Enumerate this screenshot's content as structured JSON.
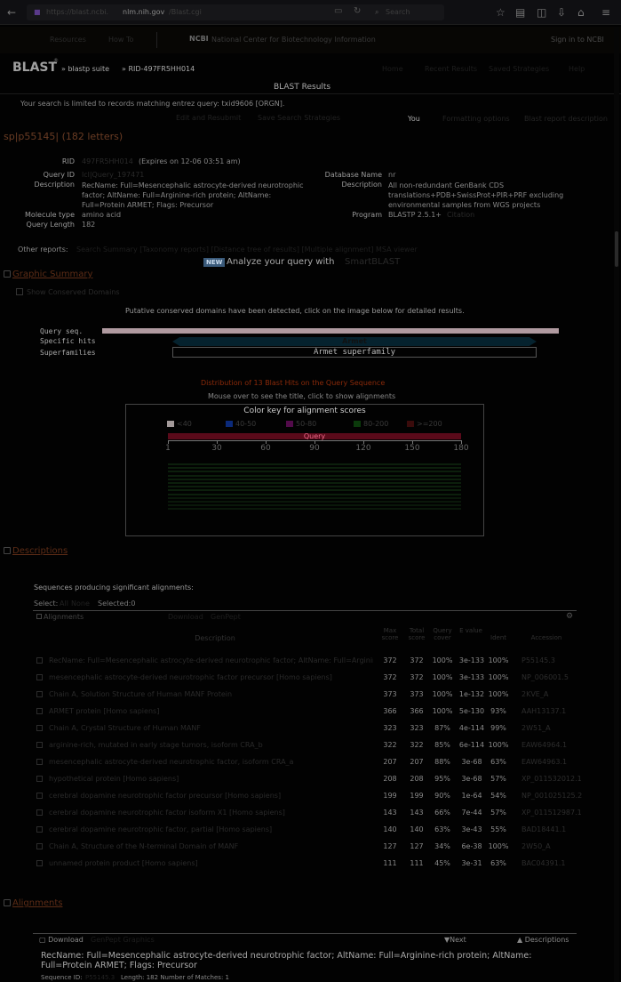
{
  "browser": {
    "url_prefix": "https://blast.ncbi.",
    "url_domain": "nlm.nih.gov",
    "url_suffix": "/Blast.cgi",
    "search_placeholder": "Search"
  },
  "ncbi_bar": {
    "resources": "Resources",
    "howto": "How To",
    "logo": "NCBI",
    "name": "National Center for Biotechnology Information",
    "signin": "Sign in to NCBI"
  },
  "blast_bar": {
    "title": "BLAST",
    "reg": "®",
    "suite": "» blastp suite",
    "rid": "» RID-497FR5HH014",
    "links": [
      "Home",
      "Recent Results",
      "Saved Strategies",
      "Help"
    ]
  },
  "results_title": "BLAST Results",
  "limit_note": "Your search is limited to records matching entrez query: txid9606 [ORGN].",
  "edit_link": "Edit and Resubmit",
  "save_link": "Save Search Strategies",
  "formatting_link": "Formatting options",
  "download_link": "Download",
  "you_may": "You",
  "blast_tutorials": "Blast report description",
  "query_title": "sp|p55145| (182 letters)",
  "summary": {
    "rid_label": "RID",
    "rid_value": "497FR5HH014",
    "expires": "(Expires on 12-06 03:51 am)",
    "qid_label": "Query ID",
    "qid_value": "lcl|Query_197471",
    "desc_label": "Description",
    "desc_value": "RecName: Full=Mesencephalic astrocyte-derived neurotrophic factor; AltName: Full=Arginine-rich protein; AltName: Full=Protein ARMET; Flags: Precursor",
    "moltype_label": "Molecule type",
    "moltype_value": "amino acid",
    "qlen_label": "Query Length",
    "qlen_value": "182",
    "db_label": "Database Name",
    "db_value": "nr",
    "dbdesc_label": "Description",
    "dbdesc_value": "All non-redundant GenBank CDS translations+PDB+SwissProt+PIR+PRF excluding environmental samples from WGS projects",
    "program_label": "Program",
    "program_value": "BLASTP 2.5.1+",
    "citation": "Citation"
  },
  "other_reports": {
    "label": "Other reports:",
    "links": "Search Summary  [Taxonomy reports]  [Distance tree of results]  [Multiple alignment]  MSA viewer"
  },
  "new_badge": "NEW",
  "analyze_text": "Analyze your query with",
  "analyze_link": "SmartBLAST",
  "graphic_summary": {
    "heading": "Graphic Summary",
    "subheading": "Show Conserved Domains",
    "note": "Putative conserved domains have been detected, click on the image below for detailed results.",
    "row_labels": [
      "Query seq.",
      "Specific hits",
      "Superfamilies"
    ],
    "specific_hit": "Armet",
    "superfamily": "Armet superfamily"
  },
  "distribution": {
    "title": "Distribution of 13 Blast Hits on the Query Sequence",
    "subtitle": "Mouse over to see the title, click to show alignments",
    "key_title": "Color key for alignment scores",
    "legend": [
      {
        "label": "<40",
        "color": "#a39a9a"
      },
      {
        "label": "40-50",
        "color": "#0b2a7a"
      },
      {
        "label": "50-80",
        "color": "#520b4a"
      },
      {
        "label": "80-200",
        "color": "#0b3a0b"
      },
      {
        "label": ">=200",
        "color": "#3a0b0b"
      }
    ],
    "query_label": "Query",
    "ticks": [
      "1",
      "30",
      "60",
      "90",
      "120",
      "150",
      "180"
    ],
    "hit_count": 13
  },
  "descriptions": {
    "heading": "Descriptions",
    "producing": "Sequences producing significant alignments:",
    "select_label": "Select:",
    "select_all": "All",
    "select_none": "None",
    "selected": "Selected:0",
    "alignments_label": "Alignments",
    "download": "Download",
    "graphics": "GenPept",
    "columns": [
      "Description",
      "Max score",
      "Total score",
      "Query cover",
      "E value",
      "Ident",
      "Accession"
    ],
    "rows": [
      {
        "desc": "RecName: Full=Mesencephalic astrocyte-derived neurotrophic factor; AltName: Full=Arginine-rich protein",
        "max": "372",
        "total": "372",
        "cover": "100%",
        "e": "3e-133",
        "ident": "100%",
        "acc": "P55145.3"
      },
      {
        "desc": "mesencephalic astrocyte-derived neurotrophic factor precursor [Homo sapiens]",
        "max": "372",
        "total": "372",
        "cover": "100%",
        "e": "3e-133",
        "ident": "100%",
        "acc": "NP_006001.5"
      },
      {
        "desc": "Chain A, Solution Structure of Human MANF Protein",
        "max": "373",
        "total": "373",
        "cover": "100%",
        "e": "1e-132",
        "ident": "100%",
        "acc": "2KVE_A"
      },
      {
        "desc": "ARMET protein [Homo sapiens]",
        "max": "366",
        "total": "366",
        "cover": "100%",
        "e": "5e-130",
        "ident": "93%",
        "acc": "AAH13137.1"
      },
      {
        "desc": "Chain A, Crystal Structure of Human MANF",
        "max": "323",
        "total": "323",
        "cover": "87%",
        "e": "4e-114",
        "ident": "99%",
        "acc": "2W51_A"
      },
      {
        "desc": "arginine-rich, mutated in early stage tumors, isoform CRA_b",
        "max": "322",
        "total": "322",
        "cover": "85%",
        "e": "6e-114",
        "ident": "100%",
        "acc": "EAW64964.1"
      },
      {
        "desc": "mesencephalic astrocyte-derived neurotrophic factor, isoform CRA_a",
        "max": "207",
        "total": "207",
        "cover": "88%",
        "e": "3e-68",
        "ident": "63%",
        "acc": "EAW64963.1"
      },
      {
        "desc": "hypothetical protein [Homo sapiens]",
        "max": "208",
        "total": "208",
        "cover": "95%",
        "e": "3e-68",
        "ident": "57%",
        "acc": "XP_011532012.1"
      },
      {
        "desc": "cerebral dopamine neurotrophic factor precursor [Homo sapiens]",
        "max": "199",
        "total": "199",
        "cover": "90%",
        "e": "1e-64",
        "ident": "54%",
        "acc": "NP_001025125.2"
      },
      {
        "desc": "cerebral dopamine neurotrophic factor isoform X1 [Homo sapiens]",
        "max": "143",
        "total": "143",
        "cover": "66%",
        "e": "7e-44",
        "ident": "57%",
        "acc": "XP_011512987.1"
      },
      {
        "desc": "cerebral dopamine neurotrophic factor, partial [Homo sapiens]",
        "max": "140",
        "total": "140",
        "cover": "63%",
        "e": "3e-43",
        "ident": "55%",
        "acc": "BAD18441.1"
      },
      {
        "desc": "Chain A, Structure of the N-terminal Domain of MANF",
        "max": "127",
        "total": "127",
        "cover": "34%",
        "e": "6e-38",
        "ident": "100%",
        "acc": "2W50_A"
      },
      {
        "desc": "unnamed protein product [Homo sapiens]",
        "max": "111",
        "total": "111",
        "cover": "45%",
        "e": "3e-31",
        "ident": "63%",
        "acc": "BAC04391.1"
      }
    ]
  },
  "alignments": {
    "heading": "Alignments",
    "download": "Download",
    "graphics_link": "GenPept  Graphics",
    "sort_label": "Next",
    "desc_link": "Descriptions",
    "first_title": "RecName: Full=Mesencephalic astrocyte-derived neurotrophic factor; AltName: Full=Arginine-rich protein; AltName: Full=Protein ARMET; Flags: Precursor",
    "seq_id_label": "Sequence ID:",
    "seq_id_value": "P55145.3",
    "seq_meta": "Length: 182  Number of Matches: 1"
  }
}
